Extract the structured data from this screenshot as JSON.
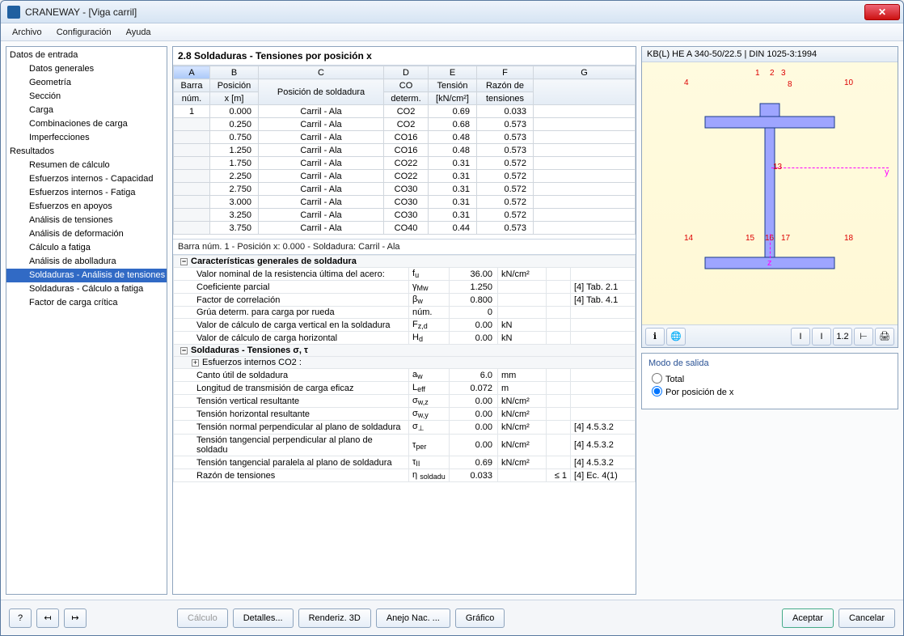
{
  "window": {
    "title": "CRANEWAY - [Viga carril]"
  },
  "menu": {
    "archivo": "Archivo",
    "config": "Configuración",
    "ayuda": "Ayuda"
  },
  "tree": {
    "datos_entrada": "Datos de entrada",
    "datos_generales": "Datos generales",
    "geometria": "Geometría",
    "seccion": "Sección",
    "carga": "Carga",
    "combinaciones": "Combinaciones de carga",
    "imperfecciones": "Imperfecciones",
    "resultados": "Resultados",
    "resumen": "Resumen de cálculo",
    "ei_cap": "Esfuerzos internos - Capacidad",
    "ei_fat": "Esfuerzos internos - Fatiga",
    "apoyos": "Esfuerzos en apoyos",
    "an_tens": "Análisis de tensiones",
    "an_def": "Análisis de deformación",
    "calc_fat": "Cálculo a fatiga",
    "an_abol": "Análisis de abolladura",
    "sold_tens": "Soldaduras - Análisis de tensiones",
    "sold_fat": "Soldaduras - Cálculo a fatiga",
    "f_crit": "Factor de carga crítica"
  },
  "section_title": "2.8 Soldaduras - Tensiones por posición x",
  "table_head": {
    "colA": "A",
    "colB": "B",
    "colC": "C",
    "colD": "D",
    "colE": "E",
    "colF": "F",
    "colG": "G",
    "barra": "Barra",
    "num": "núm.",
    "pos": "Posición",
    "xm": "x [m]",
    "posSold": "Posición de soldadura",
    "co": "CO",
    "determ": "determ.",
    "tension": "Tensión",
    "tunit": "[kN/cm²]",
    "razon1": "Razón de",
    "razon2": "tensiones"
  },
  "rows": [
    {
      "n": "1",
      "x": "0.000",
      "p": "Carril - Ala",
      "co": "CO2",
      "t": "0.69",
      "r": "0.033"
    },
    {
      "n": "",
      "x": "0.250",
      "p": "Carril - Ala",
      "co": "CO2",
      "t": "0.68",
      "r": "0.573"
    },
    {
      "n": "",
      "x": "0.750",
      "p": "Carril - Ala",
      "co": "CO16",
      "t": "0.48",
      "r": "0.573"
    },
    {
      "n": "",
      "x": "1.250",
      "p": "Carril - Ala",
      "co": "CO16",
      "t": "0.48",
      "r": "0.573"
    },
    {
      "n": "",
      "x": "1.750",
      "p": "Carril - Ala",
      "co": "CO22",
      "t": "0.31",
      "r": "0.572"
    },
    {
      "n": "",
      "x": "2.250",
      "p": "Carril - Ala",
      "co": "CO22",
      "t": "0.31",
      "r": "0.572"
    },
    {
      "n": "",
      "x": "2.750",
      "p": "Carril - Ala",
      "co": "CO30",
      "t": "0.31",
      "r": "0.572"
    },
    {
      "n": "",
      "x": "3.000",
      "p": "Carril - Ala",
      "co": "CO30",
      "t": "0.31",
      "r": "0.572"
    },
    {
      "n": "",
      "x": "3.250",
      "p": "Carril - Ala",
      "co": "CO30",
      "t": "0.31",
      "r": "0.572"
    },
    {
      "n": "",
      "x": "3.750",
      "p": "Carril - Ala",
      "co": "CO40",
      "t": "0.44",
      "r": "0.573"
    }
  ],
  "detail_title": "Barra núm.  1  -  Posición x:  0.000  -  Soldadura: Carril - Ala",
  "props": {
    "h1": "Características generales de soldadura",
    "p1": "Valor nominal de la resistencia última del acero:",
    "p1s": "fᵤ",
    "p1v": "36.00",
    "p1u": "kN/cm²",
    "p2": "Coeficiente parcial",
    "p2s": "γMw",
    "p2v": "1.250",
    "p2r": "[4] Tab. 2.1",
    "p3": "Factor de correlación",
    "p3s": "βw",
    "p3v": "0.800",
    "p3r": "[4] Tab. 4.1",
    "p4": "Grúa determ. para carga por rueda",
    "p4s": "núm.",
    "p4v": "0",
    "p5": "Valor de cálculo de carga vertical en la soldadura",
    "p5s": "Fz,d",
    "p5v": "0.00",
    "p5u": "kN",
    "p6": "Valor de cálculo de carga horizontal",
    "p6s": "Hd",
    "p6v": "0.00",
    "p6u": "kN",
    "h2": "Soldaduras - Tensiones σ, τ",
    "h2sub": "Esfuerzos internos CO2 :",
    "p7": "Canto útil de soldadura",
    "p7s": "aw",
    "p7v": "6.0",
    "p7u": "mm",
    "p8": "Longitud de transmisión de carga eficaz",
    "p8s": "Leff",
    "p8v": "0.072",
    "p8u": "m",
    "p9": "Tensión vertical resultante",
    "p9s": "σw,z",
    "p9v": "0.00",
    "p9u": "kN/cm²",
    "p10": "Tensión horizontal resultante",
    "p10s": "σw,y",
    "p10v": "0.00",
    "p10u": "kN/cm²",
    "p11": "Tensión normal perpendicular al plano de soldadura",
    "p11s": "σ⊥",
    "p11v": "0.00",
    "p11u": "kN/cm²",
    "p11r": "[4] 4.5.3.2",
    "p12": "Tensión tangencial perpendicular al plano de soldadu",
    "p12s": "τper",
    "p12v": "0.00",
    "p12u": "kN/cm²",
    "p12r": "[4] 4.5.3.2",
    "p13": "Tensión tangencial paralela al plano de soldadura",
    "p13s": "τII",
    "p13v": "0.69",
    "p13u": "kN/cm²",
    "p13r": "[4] 4.5.3.2",
    "p14": "Razón de tensiones",
    "p14s": "η soldadu",
    "p14v": "0.033",
    "p14l": "≤ 1",
    "p14r": "[4] Ec. 4(1)"
  },
  "viewer_title": "KB(L) HE A 340-50/22.5 | DIN 1025-3:1994",
  "viewer_labels": {
    "p1": "1",
    "p2": "2",
    "p3": "3",
    "p4": "4",
    "p8": "8",
    "p10": "10",
    "p13": "13",
    "p14": "14",
    "p15": "15",
    "p16": "16",
    "p17": "17",
    "p18": "18",
    "y": "y",
    "z": "z"
  },
  "outmode": {
    "title": "Modo de salida",
    "total": "Total",
    "porx": "Por posición de x"
  },
  "buttons": {
    "calculo": "Cálculo",
    "detalles": "Detalles...",
    "renderiz": "Renderiz. 3D",
    "anejo": "Anejo Nac. ...",
    "grafico": "Gráfico",
    "aceptar": "Aceptar",
    "cancelar": "Cancelar"
  }
}
